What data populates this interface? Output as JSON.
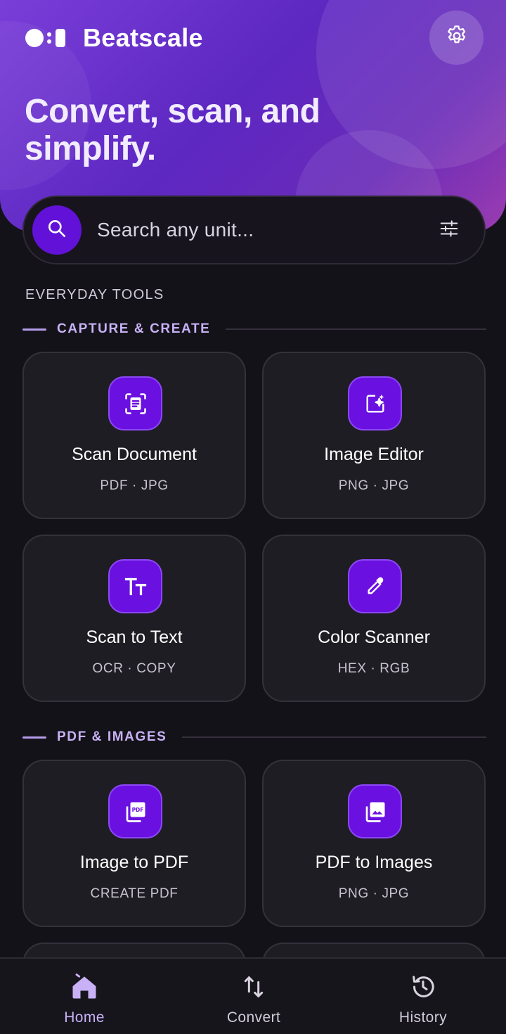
{
  "app": {
    "name": "Beatscale"
  },
  "hero": {
    "headline": "Convert, scan, and simplify."
  },
  "search": {
    "placeholder": "Search any unit..."
  },
  "section": {
    "title": "EVERYDAY TOOLS"
  },
  "groups": [
    {
      "label": "CAPTURE & CREATE",
      "tools": [
        {
          "title": "Scan Document",
          "subtitle": "PDF · JPG",
          "icon": "document-scanner-icon"
        },
        {
          "title": "Image Editor",
          "subtitle": "PNG · JPG",
          "icon": "image-edit-sparkle-icon"
        },
        {
          "title": "Scan to Text",
          "subtitle": "OCR · COPY",
          "icon": "text-fields-icon"
        },
        {
          "title": "Color Scanner",
          "subtitle": "HEX · RGB",
          "icon": "eyedropper-icon"
        }
      ]
    },
    {
      "label": "PDF & IMAGES",
      "tools": [
        {
          "title": "Image to PDF",
          "subtitle": "CREATE PDF",
          "icon": "pdf-file-icon"
        },
        {
          "title": "PDF to Images",
          "subtitle": "PNG · JPG",
          "icon": "photo-library-icon"
        }
      ]
    }
  ],
  "nav": [
    {
      "label": "Home",
      "icon": "home-icon",
      "active": true
    },
    {
      "label": "Convert",
      "icon": "swap-vertical-icon",
      "active": false
    },
    {
      "label": "History",
      "icon": "history-icon",
      "active": false
    }
  ],
  "colors": {
    "accent": "#6a10e0",
    "background": "#141219",
    "card": "#1f1d24"
  }
}
